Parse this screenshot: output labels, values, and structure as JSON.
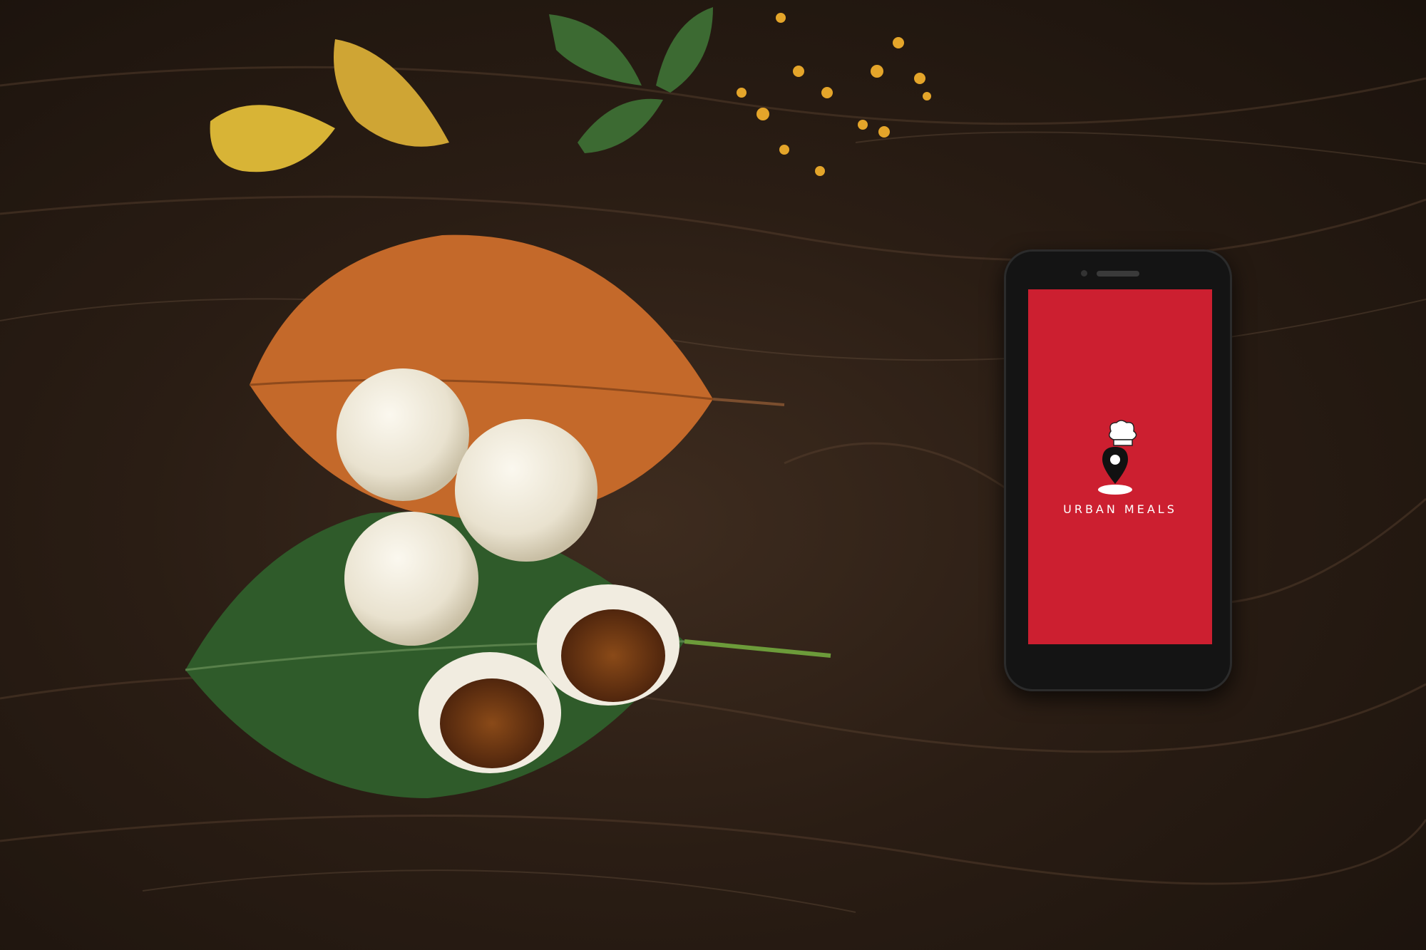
{
  "app": {
    "brand_name": "URBAN MEALS",
    "screen_color": "#cc1f30",
    "logo_icon": "chef-hat-location-pin-icon"
  }
}
